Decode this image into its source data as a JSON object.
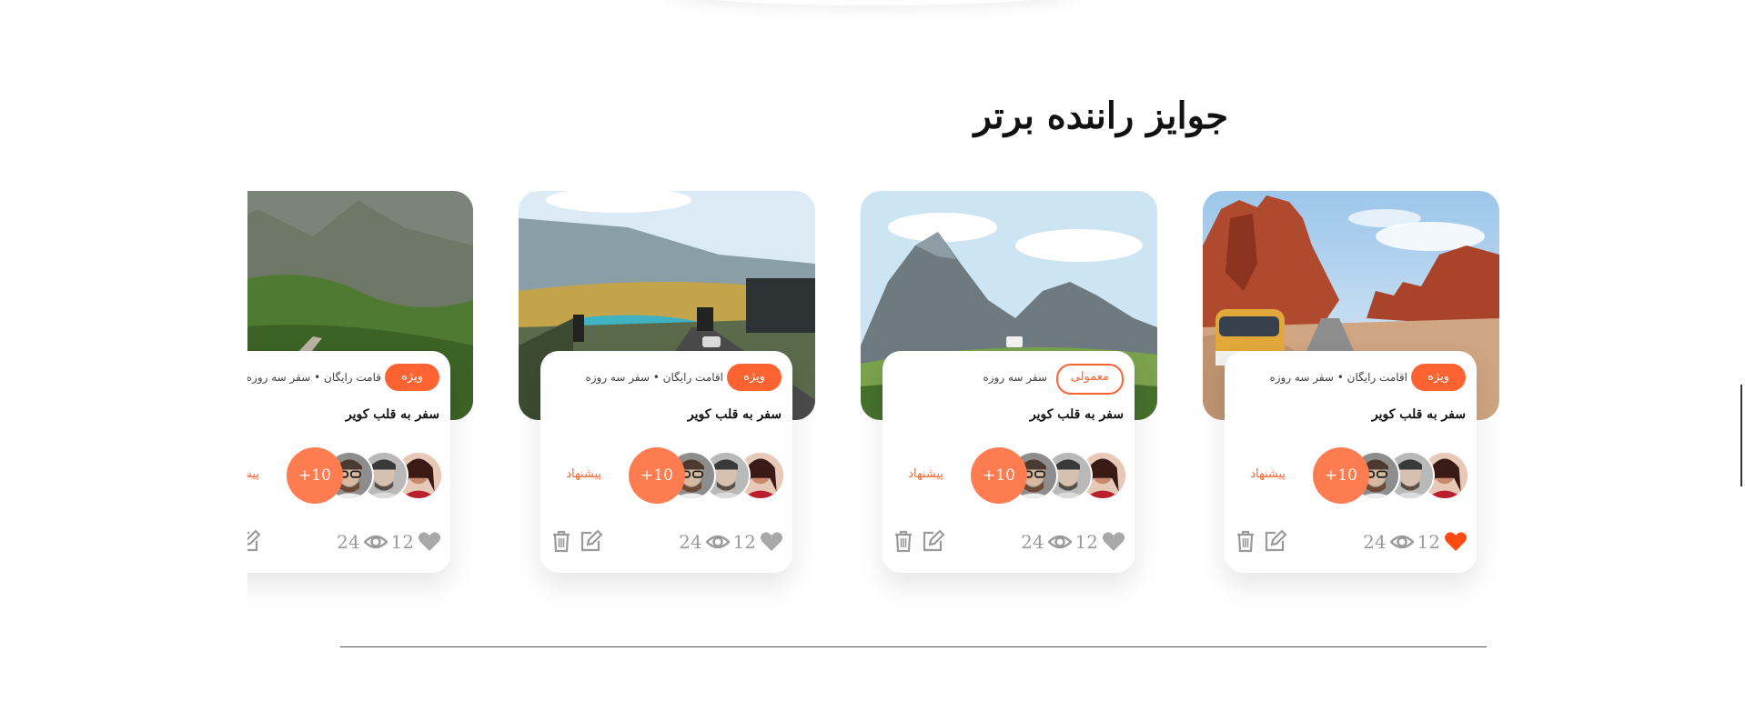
{
  "section": {
    "title": "جوایز راننده برتر"
  },
  "cards": [
    {
      "tag": "ویژه",
      "tag_style": "filled",
      "meta": "اقامت رایگان • سفر سه روزه",
      "title": "سفر به قلب کویر",
      "plus_label": "+10",
      "suggest_label": "پیشنهاد",
      "views": "24",
      "likes": "12",
      "liked": true,
      "scene": "desert-canyon-van"
    },
    {
      "tag": "معمولی",
      "tag_style": "outline",
      "meta": "سفر سه روزه",
      "title": "سفر به قلب کویر",
      "plus_label": "+10",
      "suggest_label": "پیشنهاد",
      "views": "24",
      "likes": "12",
      "liked": false,
      "scene": "mountain-valley"
    },
    {
      "tag": "ویژه",
      "tag_style": "filled",
      "meta": "اقامت رایگان • سفر سه روزه",
      "title": "سفر به قلب کویر",
      "plus_label": "+10",
      "suggest_label": "پیشنهاد",
      "views": "24",
      "likes": "12",
      "liked": false,
      "scene": "lake-highway"
    },
    {
      "tag": "ویژه",
      "tag_style": "filled",
      "meta": "قامت رایگان • سفر سه روزه",
      "title": "سفر به قلب کویر",
      "plus_label": "+10",
      "suggest_label": "پیشنهاد",
      "views": "24",
      "likes": "12",
      "liked": false,
      "scene": "green-hills-road"
    }
  ],
  "icons": {
    "views": "eye-icon",
    "likes": "heart-icon",
    "edit": "edit-icon",
    "delete": "trash-icon"
  },
  "colors": {
    "accent": "#ff6332",
    "accent_light": "#ff7c50",
    "muted": "#9a9a9a",
    "liked": "#ff4a12"
  }
}
